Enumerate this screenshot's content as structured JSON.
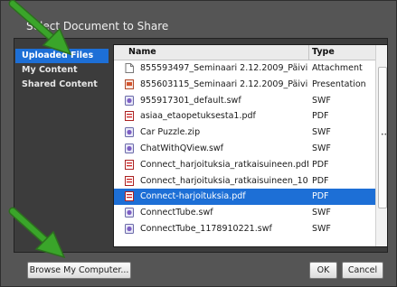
{
  "dialog": {
    "title": "Select Document to Share"
  },
  "sidebar": {
    "items": [
      {
        "label": "Uploaded Files",
        "selected": true
      },
      {
        "label": "My Content",
        "selected": false
      },
      {
        "label": "Shared Content",
        "selected": false
      }
    ]
  },
  "table": {
    "headers": {
      "name": "Name",
      "type": "Type"
    },
    "rows": [
      {
        "name": "855593497_Seminaari 2.12.2009_Päivi.ppt",
        "type": "Attachment",
        "icon": "document-icon"
      },
      {
        "name": "855603115_Seminaari 2.12.2009_Päivi.ppt",
        "type": "Presentation",
        "icon": "presentation-icon"
      },
      {
        "name": "955917301_default.swf",
        "type": "SWF",
        "icon": "swf-icon"
      },
      {
        "name": "asiaa_etaopetuksesta1.pdf",
        "type": "PDF",
        "icon": "pdf-icon"
      },
      {
        "name": "Car Puzzle.zip",
        "type": "SWF",
        "icon": "swf-icon"
      },
      {
        "name": "ChatWithQView.swf",
        "type": "SWF",
        "icon": "swf-icon"
      },
      {
        "name": "Connect_harjoituksia_ratkaisuineen.pdf",
        "type": "PDF",
        "icon": "pdf-icon"
      },
      {
        "name": "Connect_harjoituksia_ratkaisuineen_1086905...",
        "type": "PDF",
        "icon": "pdf-icon"
      },
      {
        "name": "Connect-harjoituksia.pdf",
        "type": "PDF",
        "icon": "pdf-icon",
        "selected": true
      },
      {
        "name": "ConnectTube.swf",
        "type": "SWF",
        "icon": "swf-icon"
      },
      {
        "name": "ConnectTube_1178910221.swf",
        "type": "SWF",
        "icon": "swf-icon"
      }
    ]
  },
  "buttons": {
    "browse": "Browse My Computer...",
    "ok": "OK",
    "cancel": "Cancel"
  },
  "colors": {
    "selection": "#1d6fd6",
    "annotation_arrow": "#3aa52a"
  }
}
